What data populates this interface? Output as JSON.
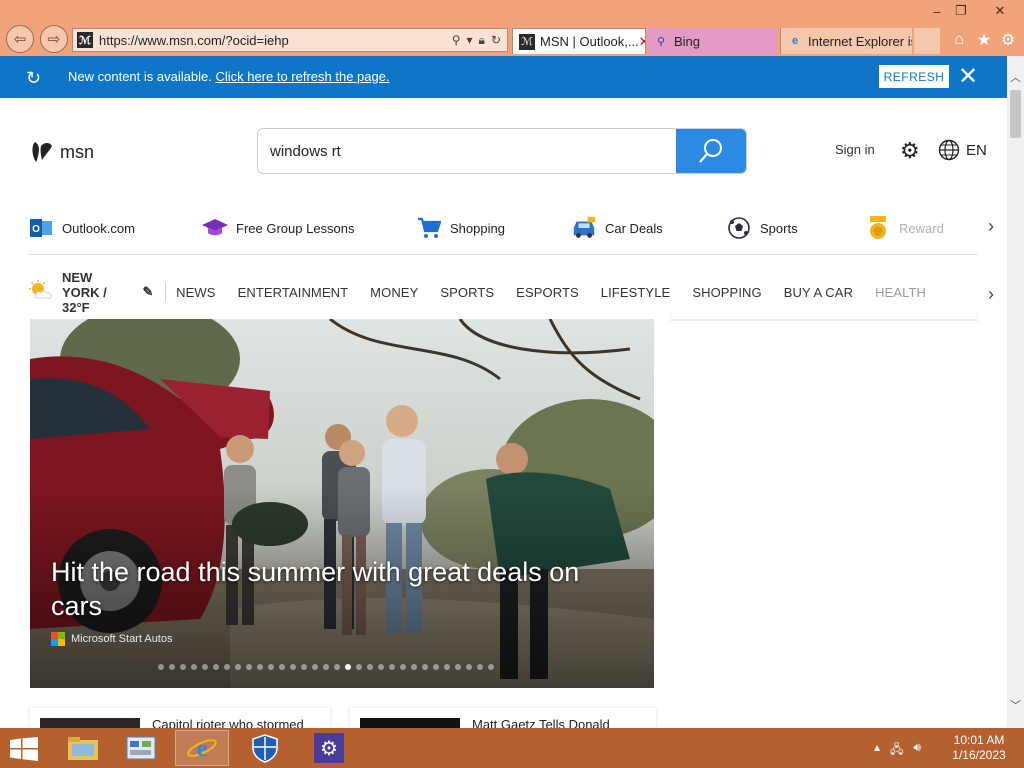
{
  "browser": {
    "address_url": "https://www.msn.com/?ocid=iehp",
    "tabs": [
      {
        "label": "MSN | Outlook,...",
        "active": true
      },
      {
        "label": "Bing",
        "active": false
      },
      {
        "label": "Internet Explorer is...",
        "active": false
      }
    ],
    "window_controls": {
      "minimize": "–",
      "restore": "❐",
      "close": "✕"
    }
  },
  "notification": {
    "message": "New content is available.",
    "link": "Click here to refresh the page.",
    "button": "REFRESH"
  },
  "msn": {
    "logo_text": "msn",
    "search_value": "windows rt",
    "sign_in": "Sign in",
    "language": "EN"
  },
  "quick_links": [
    {
      "label": "Outlook.com",
      "icon": "outlook-icon"
    },
    {
      "label": "Free Group Lessons",
      "icon": "graduation-cap-icon"
    },
    {
      "label": "Shopping",
      "icon": "cart-icon"
    },
    {
      "label": "Car Deals",
      "icon": "car-icon"
    },
    {
      "label": "Sports",
      "icon": "soccer-ball-icon"
    },
    {
      "label": "Reward",
      "icon": "medal-icon"
    }
  ],
  "weather": {
    "label": "NEW YORK / 32°F"
  },
  "categories": [
    "NEWS",
    "ENTERTAINMENT",
    "MONEY",
    "SPORTS",
    "ESPORTS",
    "LIFESTYLE",
    "SHOPPING",
    "BUY A CAR",
    "HEALTH"
  ],
  "hero": {
    "headline": "Hit the road this summer with great deals on cars",
    "source": "Microsoft Start Autos",
    "slide_count": 31,
    "active_slide": 17
  },
  "cards": [
    {
      "title": "Capitol rioter who stormed"
    },
    {
      "title": "Matt Gaetz Tells Donald"
    }
  ],
  "taskbar": {
    "time": "10:01 AM",
    "date": "1/16/2023"
  },
  "colors": {
    "chrome": "#f1a47c",
    "notice": "#0f76c7",
    "search_button": "#2c8ae3",
    "taskbar": "#b5602f"
  }
}
